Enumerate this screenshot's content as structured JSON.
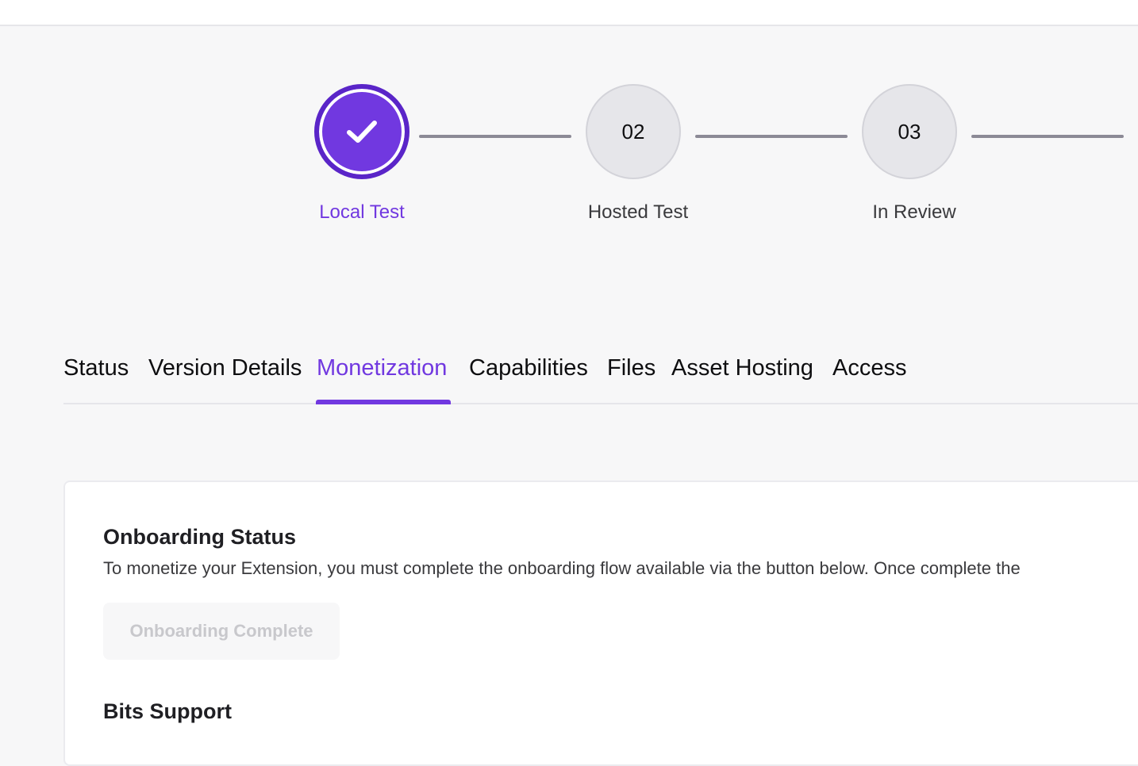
{
  "colors": {
    "accent": "#7138e0",
    "connector": "#8c8a96",
    "pending_circle": "#e6e6ea"
  },
  "stepper": {
    "steps": [
      {
        "label": "Local Test",
        "number": "",
        "state": "complete",
        "icon": "checkmark-icon"
      },
      {
        "label": "Hosted Test",
        "number": "02",
        "state": "pending"
      },
      {
        "label": "In Review",
        "number": "03",
        "state": "pending"
      }
    ]
  },
  "tabs": {
    "items": [
      {
        "label": "Status"
      },
      {
        "label": "Version Details"
      },
      {
        "label": "Monetization",
        "active": true
      },
      {
        "label": "Capabilities"
      },
      {
        "label": "Files"
      },
      {
        "label": "Asset Hosting"
      },
      {
        "label": "Access"
      }
    ]
  },
  "onboarding": {
    "title": "Onboarding Status",
    "description": "To monetize your Extension, you must complete the onboarding flow available via the button below. Once complete the",
    "button_label": "Onboarding Complete"
  },
  "bits": {
    "title": "Bits Support"
  }
}
